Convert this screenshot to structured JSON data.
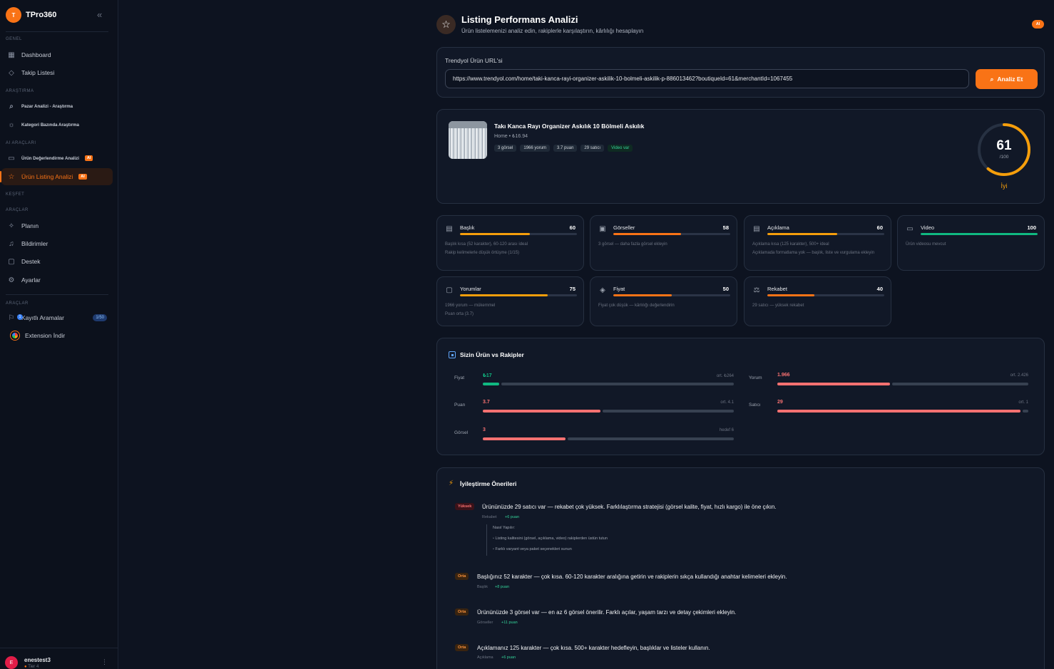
{
  "brand": {
    "logo_letter": "T",
    "name": "TPro360"
  },
  "sidebar": {
    "sections": {
      "genel": "GENEL",
      "arastirma": "ARAŞTIRMA",
      "ai_araclari": "AI ARAÇLARI",
      "kesfet": "KEŞFET",
      "araclar": "ARAÇLAR",
      "araclar2": "ARAÇLAR"
    },
    "items": {
      "dashboard": "Dashboard",
      "takip": "Takip Listesi",
      "pazar": "Pazar Analizi - Araştırma",
      "kategori": "Kategori Bazında Araştırma",
      "urun_deger": "Ürün Değerlendirme Analizi",
      "listing": "Ürün Listing Analizi",
      "planin": "Planın",
      "bildirimler": "Bildirimler",
      "destek": "Destek",
      "ayarlar": "Ayarlar",
      "kayitli": "Kayıtlı Aramalar",
      "extension": "Extension İndir"
    },
    "ai_tag": "AI",
    "saved_count": "1/50",
    "saved_badge": "1"
  },
  "user": {
    "initial": "E",
    "name": "enestest3",
    "tier": "Tier 4"
  },
  "header": {
    "title": "Listing Performans Analizi",
    "subtitle": "Ürün listelemenizi analiz edin, rakiplerle karşılaştırın, kârlılığı hesaplayın",
    "ai_badge": "AI"
  },
  "url_form": {
    "label": "Trendyol Ürün URL'si",
    "value": "https://www.trendyol.com/home/taki-kanca-rayi-organizer-askilik-10-bolmeli-askilik-p-886013462?boutiqueId=61&merchantId=1067455",
    "button": "Analiz Et"
  },
  "product": {
    "title": "Takı Kanca Rayı Organizer Askılık 10 Bölmeli Askılık",
    "meta": "Home • ₺16.94",
    "chips": [
      "3 görsel",
      "1966 yorum",
      "3.7 puan",
      "29 satıcı"
    ],
    "video_chip": "Video var",
    "score": 61,
    "score_den": "/100",
    "score_label": "İyi"
  },
  "metrics": [
    {
      "name": "Başlık",
      "score": 60,
      "icon": "document-icon",
      "color": "#f59e0b",
      "notes": [
        "Başlık kısa (52 karakter), 60-120 arası ideal",
        "Rakip kelimelerle düşük örtüşme (1/15)"
      ]
    },
    {
      "name": "Görseller",
      "score": 58,
      "icon": "image-icon",
      "color": "#f97316",
      "notes": [
        "3 görsel — daha fazla görsel ekleyin"
      ]
    },
    {
      "name": "Açıklama",
      "score": 60,
      "icon": "document-icon",
      "color": "#f59e0b",
      "notes": [
        "Açıklama kısa (125 karakter), 500+ ideal",
        "Açıklamada formatlama yok — başlık, liste ve vurgulama ekleyin"
      ]
    },
    {
      "name": "Video",
      "score": 100,
      "icon": "video-icon",
      "color": "#10b981",
      "notes": [
        "Ürün videosu mevcut"
      ]
    },
    {
      "name": "Yorumlar",
      "score": 75,
      "icon": "comment-icon",
      "color": "#f59e0b",
      "notes": [
        "1966 yorum — mükemmel",
        "Puan orta (3.7)"
      ]
    },
    {
      "name": "Fiyat",
      "score": 50,
      "icon": "tag-icon",
      "color": "#f97316",
      "notes": [
        "Fiyat çok düşük — kârlılığı değerlendirin"
      ]
    },
    {
      "name": "Rekabet",
      "score": 40,
      "icon": "competition-icon",
      "color": "#f97316",
      "notes": [
        "29 satıcı — yüksek rekabet"
      ]
    }
  ],
  "comparison": {
    "title": "Sizin Ürün vs Rakipler",
    "rows": [
      {
        "label": "Fiyat",
        "value": "₺17",
        "avg": "ort. ₺264",
        "color": "#10b981",
        "fraction": 0.064
      },
      {
        "label": "Yorum",
        "value": "1.966",
        "avg": "ort. 2.426",
        "color": "#f87171",
        "fraction": 0.45
      },
      {
        "label": "Puan",
        "value": "3.7",
        "avg": "ort. 4.1",
        "color": "#f87171",
        "fraction": 0.47
      },
      {
        "label": "Satıcı",
        "value": "29",
        "avg": "ort. 1",
        "color": "#f87171",
        "fraction": 0.97
      },
      {
        "label": "Görsel",
        "value": "3",
        "avg": "hedef 6",
        "color": "#f87171",
        "fraction": 0.33
      }
    ]
  },
  "recommendations": {
    "title": "İyileştirme Önerileri",
    "items": [
      {
        "priority": "Yüksek",
        "text": "Ürününüzde 29 satıcı var — rekabet çok yüksek. Farklılaştırma stratejisi (görsel kalite, fiyat, hızlı kargo) ile öne çıkın.",
        "category": "Rekabet",
        "points": "+6 puan"
      },
      {
        "priority": "Orta",
        "text": "Başlığınız 52 karakter — çok kısa. 60-120 karakter aralığına getirin ve rakiplerin sıkça kullandığı anahtar kelimeleri ekleyin.",
        "category": "Başlık",
        "points": "+8 puan"
      },
      {
        "priority": "Orta",
        "text": "Ürününüzde 3 görsel var — en az 6 görsel önerilir. Farklı açılar, yaşam tarzı ve detay çekimleri ekleyin.",
        "category": "Görseller",
        "points": "+11 puan"
      },
      {
        "priority": "Orta",
        "text": "Açıklamanız 125 karakter — çok kısa. 500+ karakter hedefleyin, başlıklar ve listeler kullanın.",
        "category": "Açıklama",
        "points": "+6 puan"
      }
    ],
    "how": {
      "title": "Nasıl Yapılır:",
      "steps": [
        "Listing kalitesini (görsel, açıklama, video) rakiplerden üstün tutun",
        "Farklı varyant veya paket seçenekleri sunun"
      ]
    }
  },
  "colors": {
    "accent": "#f97316",
    "good": "#10b981",
    "bad": "#f87171",
    "warn": "#f59e0b"
  }
}
